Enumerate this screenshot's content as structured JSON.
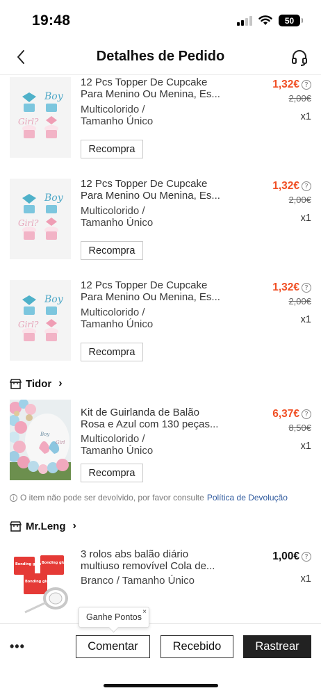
{
  "status_bar": {
    "time": "19:48",
    "battery": "50"
  },
  "header": {
    "title": "Detalhes de Pedido"
  },
  "stores": [
    {
      "name": "Tidor"
    },
    {
      "name": "Mr.Leng"
    }
  ],
  "items": [
    {
      "title_line1": "12 Pcs Topper De Cupcake",
      "title_line2": "Para Menino Ou Menina, Es...",
      "variant_line1": "Multicolorido /",
      "variant_line2": "Tamanho Único",
      "price": "1,32€",
      "old_price": "2,00€",
      "qty": "x1",
      "rebuy_label": "Recompra",
      "image_text": {
        "boy": "Boy",
        "girl": "Girl?"
      }
    },
    {
      "title_line1": "12 Pcs Topper De Cupcake",
      "title_line2": "Para Menino Ou Menina, Es...",
      "variant_line1": "Multicolorido /",
      "variant_line2": "Tamanho Único",
      "price": "1,32€",
      "old_price": "2,00€",
      "qty": "x1",
      "rebuy_label": "Recompra",
      "image_text": {
        "boy": "Boy",
        "girl": "Girl?"
      }
    },
    {
      "title_line1": "12 Pcs Topper De Cupcake",
      "title_line2": "Para Menino Ou Menina, Es...",
      "variant_line1": "Multicolorido /",
      "variant_line2": "Tamanho Único",
      "price": "1,32€",
      "old_price": "2,00€",
      "qty": "x1",
      "rebuy_label": "Recompra",
      "image_text": {
        "boy": "Boy",
        "girl": "Girl?"
      }
    },
    {
      "title_line1": "Kit de Guirlanda de Balão",
      "title_line2": "Rosa e Azul com 130 peças...",
      "variant_line1": "Multicolorido /",
      "variant_line2": "Tamanho Único",
      "price": "6,37€",
      "old_price": "8,50€",
      "qty": "x1",
      "rebuy_label": "Recompra",
      "image_text": {
        "boy": "Boy",
        "girl": "Girl"
      }
    },
    {
      "title_line1": "3 rolos abs balão diário",
      "title_line2": "multiuso removível Cola de...",
      "variant_line1": "Branco / Tamanho Único",
      "price": "1,00€",
      "qty": "x1",
      "image_text": {
        "glue1": "Bonding glue",
        "glue2": "Bonding glue",
        "glue3": "Bonding glue"
      }
    }
  ],
  "return_note": {
    "text": "O item não pode ser devolvido, por favor consulte",
    "link": "Política de Devolução"
  },
  "tooltip": {
    "label": "Ganhe Pontos",
    "close": "×"
  },
  "bottom_bar": {
    "more": "•••",
    "comment": "Comentar",
    "received": "Recebido",
    "track": "Rastrear"
  },
  "colors": {
    "price_accent": "#f04e23",
    "link": "#2f5a9e",
    "dark_button": "#222222"
  }
}
